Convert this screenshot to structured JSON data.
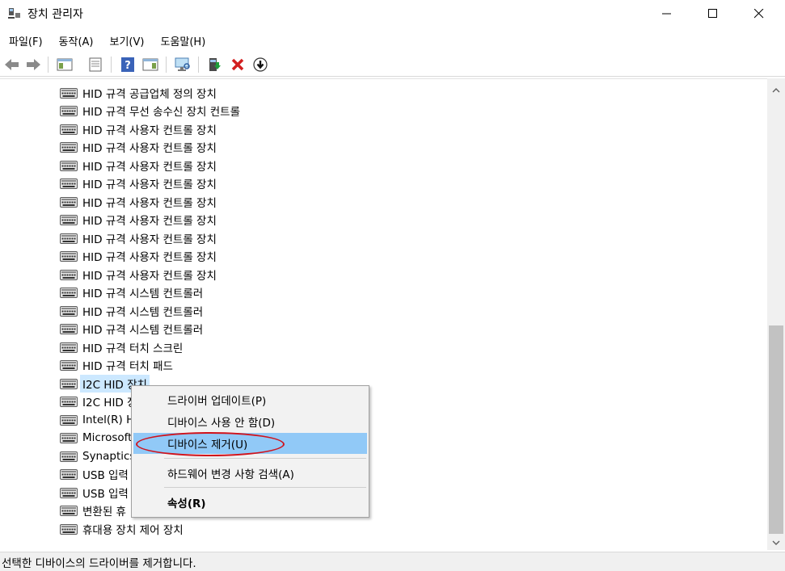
{
  "window": {
    "title": "장치 관리자",
    "icon": "device-manager-icon"
  },
  "menu": [
    "파일(F)",
    "동작(A)",
    "보기(V)",
    "도움말(H)"
  ],
  "toolbar": {
    "icons": [
      "back-arrow-icon",
      "forward-arrow-icon",
      "show-hide-console-tree-icon",
      "properties-icon",
      "help-icon",
      "action-pane-icon",
      "scan-hardware-icon",
      "update-driver-icon",
      "uninstall-device-icon",
      "disable-device-icon"
    ]
  },
  "tree": {
    "items": [
      "HID 규격 공급업체 정의 장치",
      "HID 규격 무선 송수신 장치 컨트롤",
      "HID 규격 사용자 컨트롤 장치",
      "HID 규격 사용자 컨트롤 장치",
      "HID 규격 사용자 컨트롤 장치",
      "HID 규격 사용자 컨트롤 장치",
      "HID 규격 사용자 컨트롤 장치",
      "HID 규격 사용자 컨트롤 장치",
      "HID 규격 사용자 컨트롤 장치",
      "HID 규격 사용자 컨트롤 장치",
      "HID 규격 사용자 컨트롤 장치",
      "HID 규격 시스템 컨트롤러",
      "HID 규격 시스템 컨트롤러",
      "HID 규격 시스템 컨트롤러",
      "HID 규격 터치 스크린",
      "HID 규격 터치 패드",
      "I2C HID 장치",
      "I2C HID 장",
      "Intel(R) H",
      "Microsoft",
      "Synaptics",
      "USB 입력",
      "USB 입력",
      "변환된 휴",
      "휴대용 장치 제어 장치"
    ],
    "selected_index": 16
  },
  "context_menu": {
    "items": [
      "드라이버 업데이트(P)",
      "디바이스 사용 안 함(D)",
      "디바이스 제거(U)",
      "하드웨어 변경 사항 검색(A)",
      "속성(R)"
    ],
    "highlighted_index": 2,
    "highlight_color": "#91c9f7",
    "annotation_color": "#d0121b"
  },
  "status": {
    "text": "선택한 디바이스의 드라이버를 제거합니다."
  }
}
